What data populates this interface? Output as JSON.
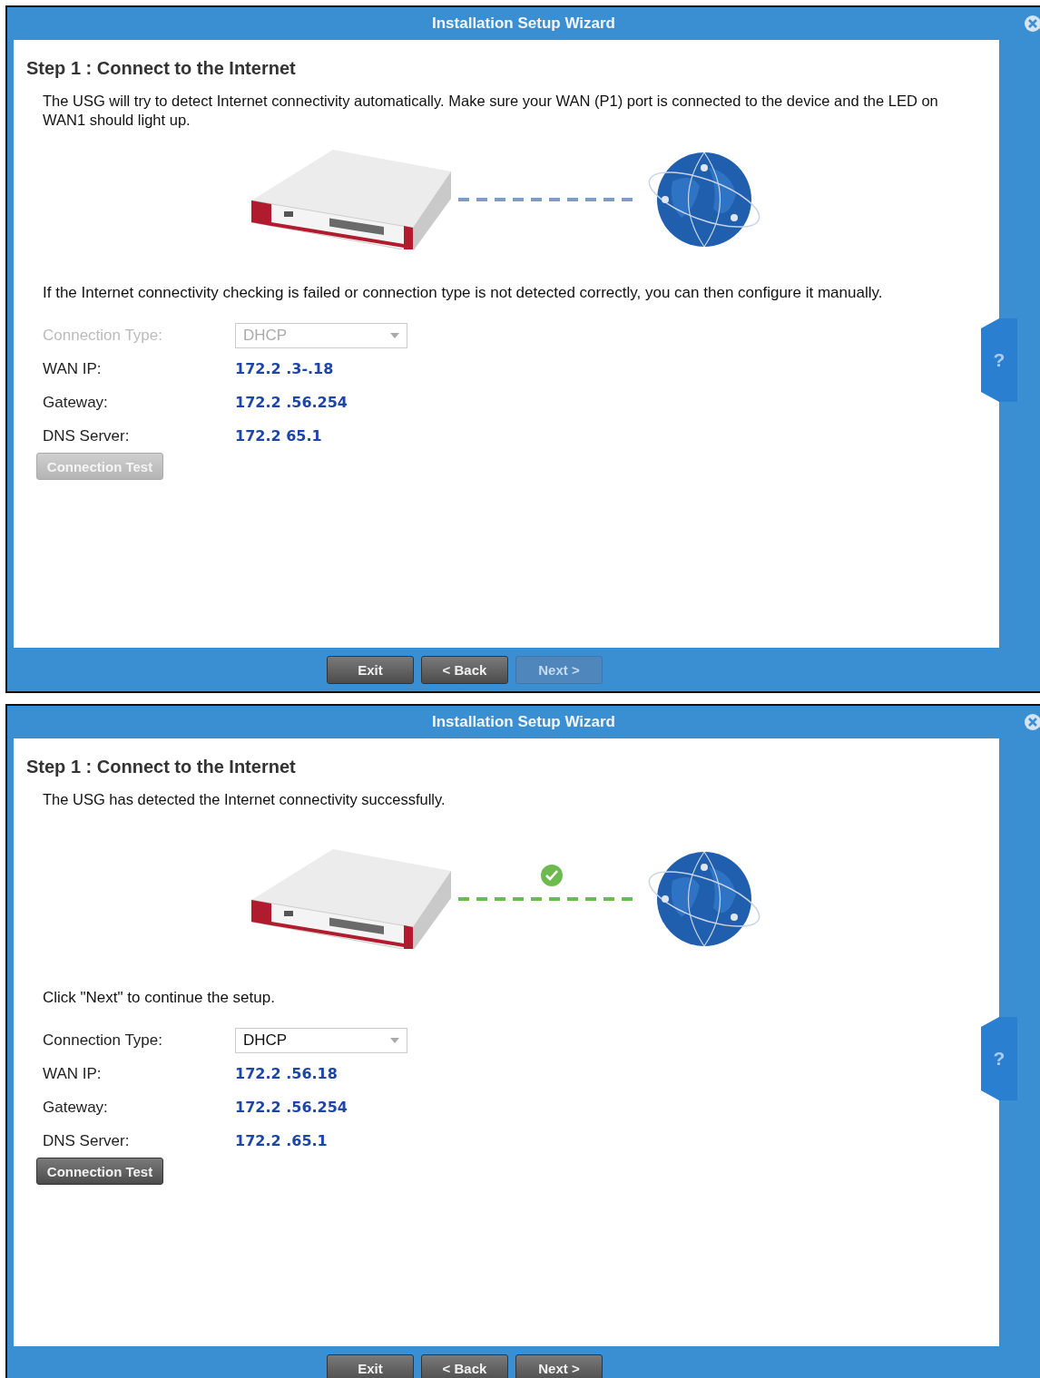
{
  "windows": [
    {
      "title": "Installation Setup Wizard",
      "heading": "Step 1 : Connect to the Internet",
      "intro": "The USG will try to detect Internet connectivity automatically. Make sure your WAN (P1) port is connected to the device and the LED on WAN1 should light up.",
      "connected": false,
      "note": "If the Internet connectivity checking is failed or connection type is not detected correctly, you can then configure it manually.",
      "connection_type": {
        "label": "Connection Type:",
        "value": "DHCP",
        "disabled": true
      },
      "info": [
        {
          "label": "WAN IP:",
          "value": "172.2 .3-.18"
        },
        {
          "label": "Gateway:",
          "value": "172.2 .56.254"
        },
        {
          "label": "DNS Server:",
          "value": "172.2 65.1"
        }
      ],
      "test_button": {
        "label": "Connection Test",
        "disabled": true
      },
      "help": "?",
      "buttons": [
        {
          "label": "Exit",
          "disabled": false
        },
        {
          "label": "< Back",
          "disabled": false
        },
        {
          "label": "Next >",
          "disabled": true
        }
      ]
    },
    {
      "title": "Installation Setup Wizard",
      "heading": "Step 1 : Connect to the Internet",
      "intro": "The USG has detected the Internet connectivity successfully.",
      "connected": true,
      "note": "Click \"Next\" to continue the setup.",
      "connection_type": {
        "label": "Connection Type:",
        "value": "DHCP",
        "disabled": false
      },
      "info": [
        {
          "label": "WAN IP:",
          "value": "172.2 .56.18"
        },
        {
          "label": "Gateway:",
          "value": "172.2 .56.254"
        },
        {
          "label": "DNS Server:",
          "value": "172.2 .65.1"
        }
      ],
      "test_button": {
        "label": "Connection Test",
        "disabled": false
      },
      "help": "?",
      "buttons": [
        {
          "label": "Exit",
          "disabled": false
        },
        {
          "label": "< Back",
          "disabled": false
        },
        {
          "label": "Next >",
          "disabled": false
        }
      ]
    }
  ]
}
